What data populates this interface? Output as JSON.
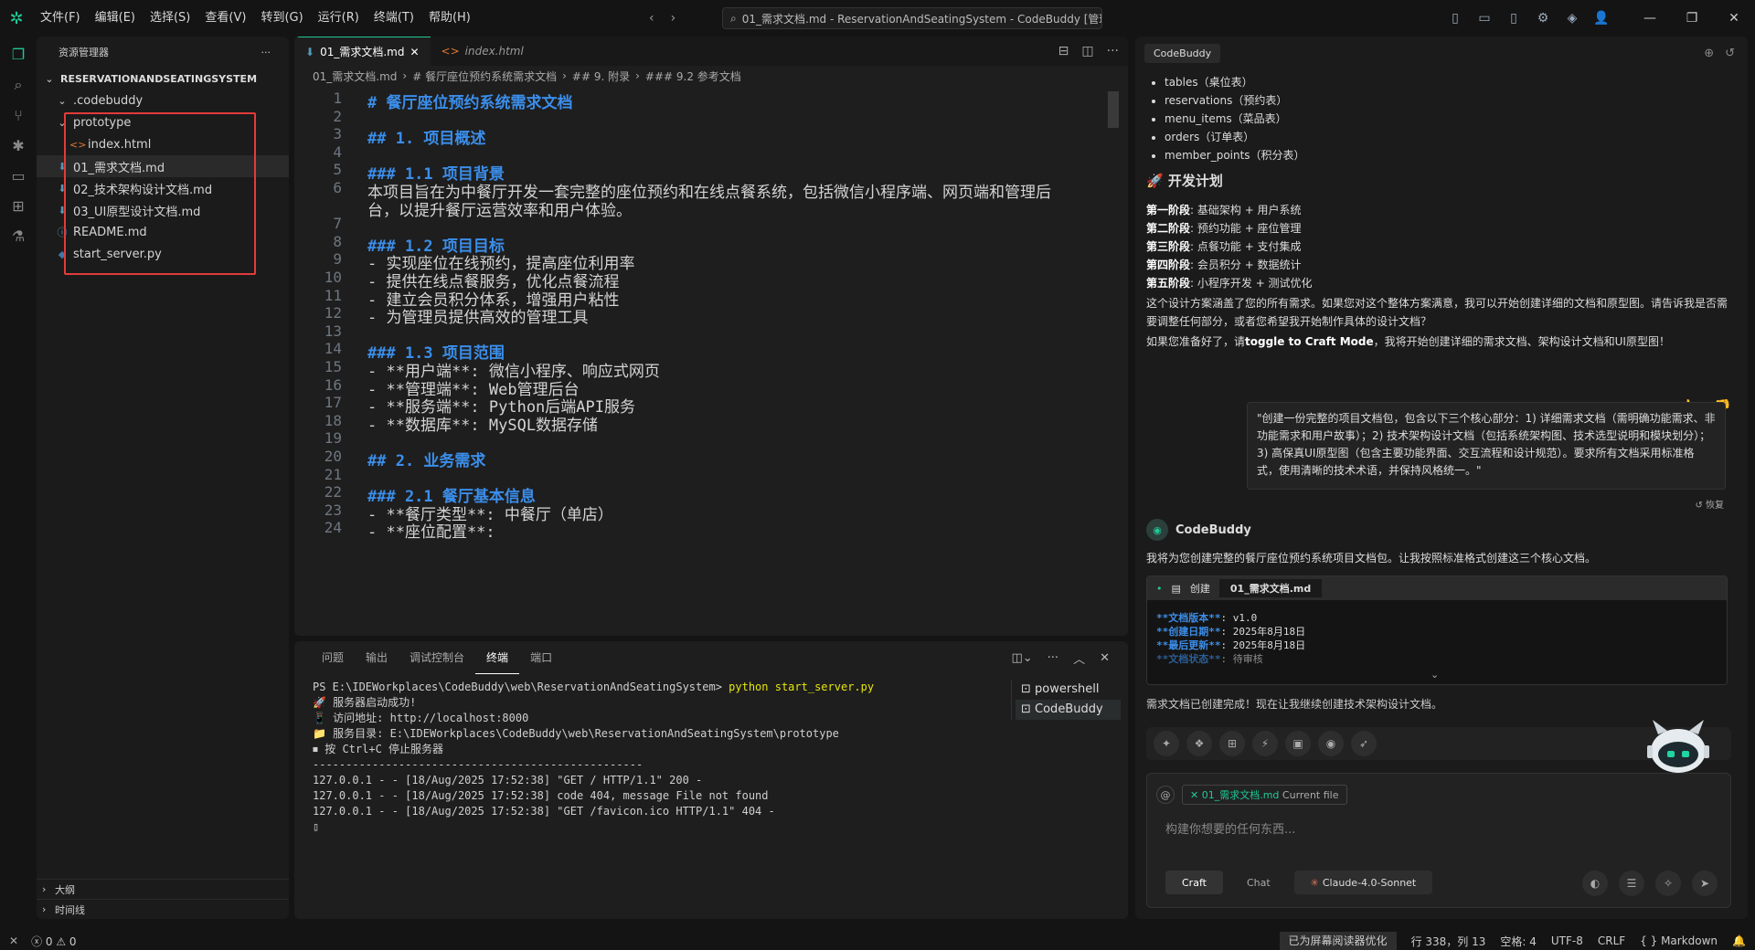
{
  "menu": [
    "文件(F)",
    "编辑(E)",
    "选择(S)",
    "查看(V)",
    "转到(G)",
    "运行(R)",
    "终端(T)",
    "帮助(H)"
  ],
  "search_text": "01_需求文档.md - ReservationAndSeatingSystem - CodeBuddy [管理员]",
  "explorer": {
    "title": "资源管理器",
    "project": "RESERVATIONANDSEATINGSYSTEM",
    "items": [
      {
        "label": ".codebuddy",
        "icon": "⌄",
        "depth": 1,
        "color": "#cccccc"
      },
      {
        "label": "prototype",
        "icon": "⌄",
        "depth": 1,
        "color": "#cccccc"
      },
      {
        "label": "index.html",
        "icon": "<>",
        "depth": 2,
        "color": "#e37933"
      },
      {
        "label": "01_需求文档.md",
        "icon": "⬇",
        "depth": 1,
        "color": "#519aba"
      },
      {
        "label": "02_技术架构设计文档.md",
        "icon": "⬇",
        "depth": 1,
        "color": "#519aba"
      },
      {
        "label": "03_UI原型设计文档.md",
        "icon": "⬇",
        "depth": 1,
        "color": "#519aba"
      },
      {
        "label": "README.md",
        "icon": "ⓘ",
        "depth": 1,
        "color": "#519aba"
      },
      {
        "label": "start_server.py",
        "icon": "◆",
        "depth": 1,
        "color": "#3c78aa"
      }
    ],
    "outline": "大纲",
    "timeline": "时间线"
  },
  "tabs": [
    {
      "label": "01_需求文档.md",
      "active": true
    },
    {
      "label": "index.html",
      "active": false
    }
  ],
  "breadcrumbs": [
    "01_需求文档.md",
    "# 餐厅座位预约系统需求文档",
    "## 9. 附录",
    "### 9.2 参考文档"
  ],
  "code_lines": [
    {
      "n": "1",
      "t": "# 餐厅座位预约系统需求文档",
      "h": true
    },
    {
      "n": "2",
      "t": "",
      "h": false
    },
    {
      "n": "3",
      "t": "## 1. 项目概述",
      "h": true
    },
    {
      "n": "4",
      "t": "",
      "h": false
    },
    {
      "n": "5",
      "t": "### 1.1 项目背景",
      "h": true
    },
    {
      "n": "6",
      "t": "本项目旨在为中餐厅开发一套完整的座位预约和在线点餐系统，包括微信小程序端、网页端和管理后",
      "h": false
    },
    {
      "n": "",
      "t": "台，以提升餐厅运营效率和用户体验。",
      "h": false
    },
    {
      "n": "7",
      "t": "",
      "h": false
    },
    {
      "n": "8",
      "t": "### 1.2 项目目标",
      "h": true
    },
    {
      "n": "9",
      "t": "- 实现座位在线预约，提高座位利用率",
      "h": false
    },
    {
      "n": "10",
      "t": "- 提供在线点餐服务，优化点餐流程",
      "h": false
    },
    {
      "n": "11",
      "t": "- 建立会员积分体系，增强用户粘性",
      "h": false
    },
    {
      "n": "12",
      "t": "- 为管理员提供高效的管理工具",
      "h": false
    },
    {
      "n": "13",
      "t": "",
      "h": false
    },
    {
      "n": "14",
      "t": "### 1.3 项目范围",
      "h": true
    },
    {
      "n": "15",
      "t": "- **用户端**: 微信小程序、响应式网页",
      "h": false
    },
    {
      "n": "16",
      "t": "- **管理端**: Web管理后台",
      "h": false
    },
    {
      "n": "17",
      "t": "- **服务端**: Python后端API服务",
      "h": false
    },
    {
      "n": "18",
      "t": "- **数据库**: MySQL数据存储",
      "h": false
    },
    {
      "n": "19",
      "t": "",
      "h": false
    },
    {
      "n": "20",
      "t": "## 2. 业务需求",
      "h": true
    },
    {
      "n": "21",
      "t": "",
      "h": false
    },
    {
      "n": "22",
      "t": "### 2.1 餐厅基本信息",
      "h": true
    },
    {
      "n": "23",
      "t": "- **餐厅类型**: 中餐厅（单店）",
      "h": false
    },
    {
      "n": "24",
      "t": "- **座位配置**:",
      "h": false
    }
  ],
  "panel": {
    "tabs": [
      "问题",
      "输出",
      "调试控制台",
      "终端",
      "端口"
    ],
    "active_tab": 3,
    "prompt": "PS E:\\IDEWorkplaces\\CodeBuddy\\web\\ReservationAndSeatingSystem> ",
    "command": "python start_server.py",
    "output": [
      "🚀 服务器启动成功!",
      "📱 访问地址: http://localhost:8000",
      "📁 服务目录: E:\\IDEWorkplaces\\CodeBuddy\\web\\ReservationAndSeatingSystem\\prototype",
      "⏹ 按 Ctrl+C 停止服务器",
      "--------------------------------------------------",
      "127.0.0.1 - - [18/Aug/2025 17:52:38] \"GET / HTTP/1.1\" 200 -",
      "127.0.0.1 - - [18/Aug/2025 17:52:38] code 404, message File not found",
      "127.0.0.1 - - [18/Aug/2025 17:52:38] \"GET /favicon.ico HTTP/1.1\" 404 -",
      "▯"
    ],
    "terminals": [
      "powershell",
      "CodeBuddy"
    ]
  },
  "assistant": {
    "tab": "CodeBuddy",
    "tables": [
      "tables（桌位表）",
      "reservations（预约表）",
      "menu_items（菜品表）",
      "orders（订单表）",
      "member_points（积分表）"
    ],
    "plan_title": "🚀 开发计划",
    "phases": [
      {
        "k": "第一阶段",
        "v": ": 基础架构 + 用户系统"
      },
      {
        "k": "第二阶段",
        "v": ": 预约功能 + 座位管理"
      },
      {
        "k": "第三阶段",
        "v": ": 点餐功能 + 支付集成"
      },
      {
        "k": "第四阶段",
        "v": ": 会员积分 + 数据统计"
      },
      {
        "k": "第五阶段",
        "v": ": 小程序开发 + 测试优化"
      }
    ],
    "summary": "这个设计方案涵盖了您的所有需求。如果您对这个整体方案满意，我可以开始创建详细的文档和原型图。请告诉我是否需要调整任何部分，或者您希望我开始制作具体的设计文档？",
    "ready_pre": "如果您准备好了，请",
    "ready_bold": "toggle to Craft Mode",
    "ready_post": "，我将开始创建详细的需求文档、架构设计文档和UI原型图！",
    "user_quote": "\"创建一份完整的项目文档包，包含以下三个核心部分：1) 详细需求文档（需明确功能需求、非功能需求和用户故事）；2) 技术架构设计文档（包括系统架构图、技术选型说明和模块划分）；3) 高保真UI原型图（包含主要功能界面、交互流程和设计规范）。要求所有文档采用标准格式，使用清晰的技术术语，并保持风格统一。\"",
    "restore": "恢复",
    "bot_name": "CodeBuddy",
    "bot_text": "我将为您创建完整的餐厅座位预约系统项目文档包。让我按照标准格式创建这三个核心文档。",
    "card_action": "创建",
    "card_file": "01_需求文档.md",
    "card_lines": [
      {
        "k": "**文档版本**",
        "v": ": v1.0"
      },
      {
        "k": "**创建日期**",
        "v": ": 2025年8月18日"
      },
      {
        "k": "**最后更新**",
        "v": ": 2025年8月18日"
      },
      {
        "k": "**文档状态**",
        "v": ": 待审核"
      }
    ],
    "next_text": "需求文档已创建完成！现在让我继续创建技术架构设计文档。",
    "context_file": "01_需求文档.md",
    "context_label": "Current file",
    "placeholder": "构建你想要的任何东西...",
    "modes": [
      "Craft",
      "Chat"
    ],
    "model": "Claude-4.0-Sonnet"
  },
  "status": {
    "errors": "0",
    "warnings": "0",
    "screenreader": "已为屏幕阅读器优化",
    "position": "行 338，列 13",
    "spaces": "空格: 4",
    "encoding": "UTF-8",
    "eol": "CRLF",
    "language": "{ } Markdown"
  }
}
